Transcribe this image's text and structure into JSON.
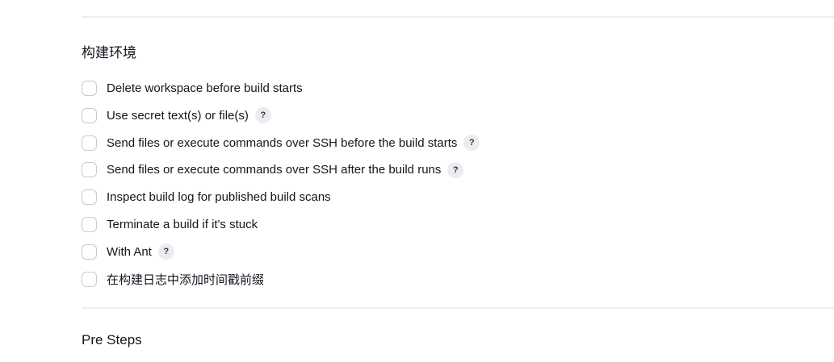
{
  "build_environment": {
    "title": "构建环境",
    "options": [
      {
        "label": "Delete workspace before build starts",
        "help": false,
        "checked": false
      },
      {
        "label": "Use secret text(s) or file(s)",
        "help": true,
        "checked": false
      },
      {
        "label": "Send files or execute commands over SSH before the build starts",
        "help": true,
        "checked": false
      },
      {
        "label": "Send files or execute commands over SSH after the build runs",
        "help": true,
        "checked": false
      },
      {
        "label": "Inspect build log for published build scans",
        "help": false,
        "checked": false
      },
      {
        "label": "Terminate a build if it's stuck",
        "help": false,
        "checked": false
      },
      {
        "label": "With Ant",
        "help": true,
        "checked": false
      },
      {
        "label": "在构建日志中添加时间戳前缀",
        "help": false,
        "checked": false
      }
    ],
    "help_glyph": "?"
  },
  "pre_steps": {
    "title": "Pre Steps"
  }
}
